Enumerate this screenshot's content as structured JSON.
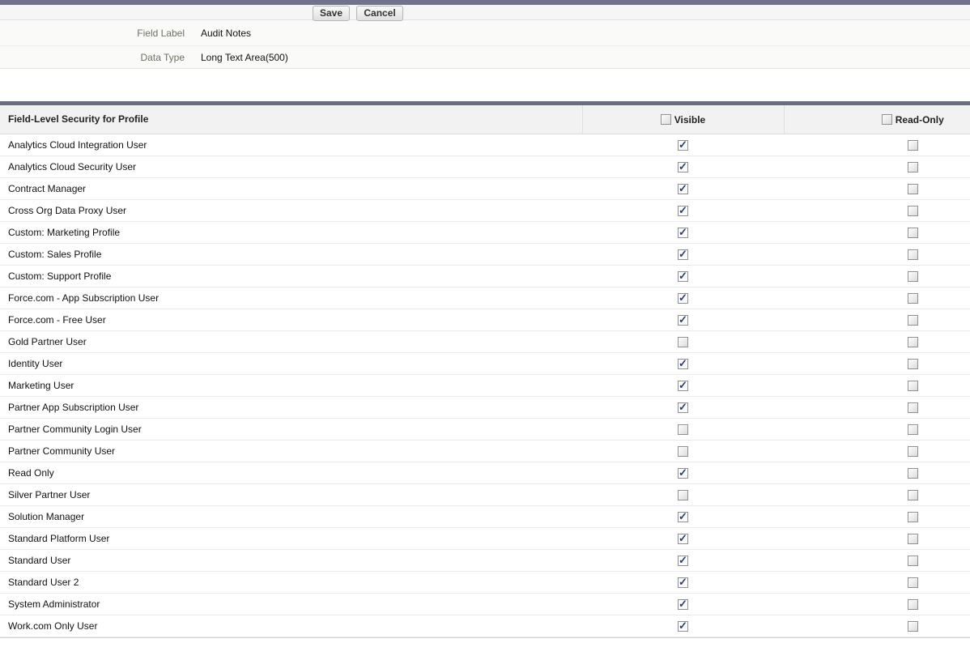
{
  "toolbar": {
    "save_label": "Save",
    "cancel_label": "Cancel"
  },
  "detail": {
    "fields": [
      {
        "label": "Field Label",
        "value": "Audit Notes"
      },
      {
        "label": "Data Type",
        "value": "Long Text Area(500)"
      }
    ]
  },
  "table": {
    "title": "Field-Level Security for Profile",
    "columns": {
      "visible": "Visible",
      "read_only": "Read-Only"
    },
    "header_visible_checked": false,
    "header_read_only_checked": false,
    "rows": [
      {
        "profile": "Analytics Cloud Integration User",
        "visible": true,
        "read_only": false
      },
      {
        "profile": "Analytics Cloud Security User",
        "visible": true,
        "read_only": false
      },
      {
        "profile": "Contract Manager",
        "visible": true,
        "read_only": false
      },
      {
        "profile": "Cross Org Data Proxy User",
        "visible": true,
        "read_only": false
      },
      {
        "profile": "Custom: Marketing Profile",
        "visible": true,
        "read_only": false
      },
      {
        "profile": "Custom: Sales Profile",
        "visible": true,
        "read_only": false
      },
      {
        "profile": "Custom: Support Profile",
        "visible": true,
        "read_only": false
      },
      {
        "profile": "Force.com - App Subscription User",
        "visible": true,
        "read_only": false
      },
      {
        "profile": "Force.com - Free User",
        "visible": true,
        "read_only": false
      },
      {
        "profile": "Gold Partner User",
        "visible": false,
        "read_only": false
      },
      {
        "profile": "Identity User",
        "visible": true,
        "read_only": false
      },
      {
        "profile": "Marketing User",
        "visible": true,
        "read_only": false
      },
      {
        "profile": "Partner App Subscription User",
        "visible": true,
        "read_only": false
      },
      {
        "profile": "Partner Community Login User",
        "visible": false,
        "read_only": false
      },
      {
        "profile": "Partner Community User",
        "visible": false,
        "read_only": false
      },
      {
        "profile": "Read Only",
        "visible": true,
        "read_only": false
      },
      {
        "profile": "Silver Partner User",
        "visible": false,
        "read_only": false
      },
      {
        "profile": "Solution Manager",
        "visible": true,
        "read_only": false
      },
      {
        "profile": "Standard Platform User",
        "visible": true,
        "read_only": false
      },
      {
        "profile": "Standard User",
        "visible": true,
        "read_only": false
      },
      {
        "profile": "Standard User 2",
        "visible": true,
        "read_only": false
      },
      {
        "profile": "System Administrator",
        "visible": true,
        "read_only": false
      },
      {
        "profile": "Work.com Only User",
        "visible": true,
        "read_only": false
      }
    ]
  },
  "colors": {
    "accent_bar": "#6f748c",
    "table_accent_bar": "#686d85",
    "check_mark": "#2c3c6e"
  }
}
